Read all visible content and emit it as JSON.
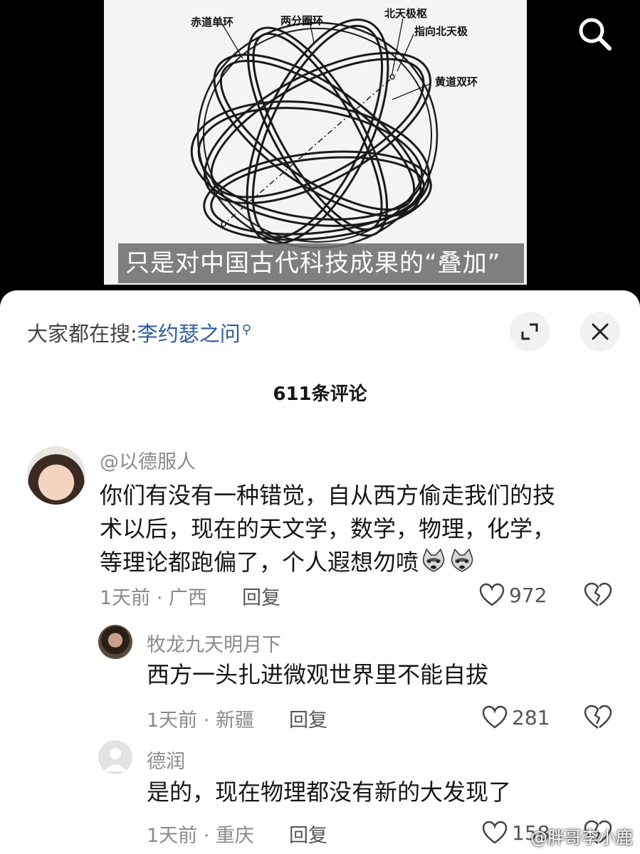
{
  "video": {
    "diagram_labels": {
      "equator_ring": "赤道单环",
      "solstice_ring": "两分圈环",
      "north_pole": "北天极枢",
      "pointing_north": "指向北天极",
      "ecliptic_rings": "黄道双环"
    },
    "subtitle": "只是对中国古代科技成果的“叠加”",
    "search_icon": "search-icon"
  },
  "sheet": {
    "hot_search_label": "大家都在搜:",
    "hot_search_term": "李约瑟之问",
    "hot_search_icon": "search-small-icon",
    "expand_icon": "expand-icon",
    "close_icon": "close-icon",
    "comment_count": "611条评论"
  },
  "comments": [
    {
      "author": "@以德服人",
      "lines": [
        "你们有没有一种错觉，自从西方偷走我们的技",
        "术以后，现在的天文学，数学，物理，化学，",
        "等理论都跑偏了，个人遐想勿喷"
      ],
      "meta": "1天前 · 广西",
      "reply": "回复",
      "likes": "972",
      "emoji_icon": "doge-icon"
    },
    {
      "author": "牧龙九天明月下",
      "lines": [
        "西方一头扎进微观世界里不能自拔"
      ],
      "meta": "1天前 · 新疆",
      "reply": "回复",
      "likes": "281"
    },
    {
      "author": "德润",
      "lines": [
        "是的，现在物理都没有新的大发现了"
      ],
      "meta": "1天前 · 重庆",
      "reply": "回复",
      "likes": "158"
    }
  ],
  "watermark": "@胖哥李小鹿",
  "colors": {
    "link": "#2f5c9a",
    "muted": "#8a8a8a",
    "text": "#161616"
  }
}
